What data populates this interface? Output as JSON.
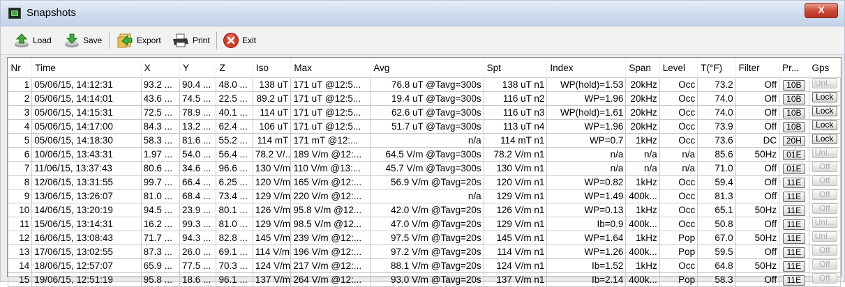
{
  "window": {
    "title": "Snapshots",
    "close_label": "X"
  },
  "toolbar": {
    "load_label": "Load",
    "save_label": "Save",
    "export_label": "Export",
    "print_label": "Print",
    "exit_label": "Exit"
  },
  "table": {
    "columns": [
      "Nr",
      "Time",
      "X",
      "Y",
      "Z",
      "Iso",
      "Max",
      "Avg",
      "Spt",
      "Index",
      "Span",
      "Level",
      "T(°F)",
      "Filter",
      "Pr...",
      "Gps"
    ],
    "rows": [
      [
        "1",
        "05/06/15, 14:12:31",
        "93.2 ...",
        "90.4 ...",
        "48.0 ...",
        "138 uT",
        "171 uT @12:5...",
        "76.8 uT @Tavg=300s",
        "138 uT n1",
        "WP(hold)=1.53",
        "20kHz",
        "Occ",
        "73.2",
        "Off",
        "10B",
        "Unl..."
      ],
      [
        "2",
        "05/06/15, 14:14:01",
        "43.6 ...",
        "74.5 ...",
        "22.5 ...",
        "89.2 uT",
        "171 uT @12:5...",
        "19.4 uT @Tavg=300s",
        "116 uT n2",
        "WP=1.96",
        "20kHz",
        "Occ",
        "74.0",
        "Off",
        "10B",
        "Lock"
      ],
      [
        "3",
        "05/06/15, 14:15:31",
        "72.5 ...",
        "78.9 ...",
        "40.1 ...",
        "114 uT",
        "171 uT @12:5...",
        "62.6 uT @Tavg=300s",
        "116 uT n3",
        "WP(hold)=1.61",
        "20kHz",
        "Occ",
        "74.0",
        "Off",
        "10B",
        "Lock"
      ],
      [
        "4",
        "05/06/15, 14:17:00",
        "84.3 ...",
        "13.2 ...",
        "62.4 ...",
        "106 uT",
        "171 uT @12:5...",
        "51.7 uT @Tavg=300s",
        "113 uT n4",
        "WP=1.96",
        "20kHz",
        "Occ",
        "73.9",
        "Off",
        "10B",
        "Lock"
      ],
      [
        "5",
        "05/06/15, 14:18:30",
        "58.3 ...",
        "81.6 ...",
        "55.2 ...",
        "114 mT",
        "171 mT @12:...",
        "n/a",
        "114 mT n1",
        "WP=0.7",
        "1kHz",
        "Occ",
        "73.6",
        "DC",
        "20H",
        "Lock"
      ],
      [
        "6",
        "10/06/15, 13:43:31",
        "1.97 ...",
        "54.0 ...",
        "56.4 ...",
        "78.2 V/...",
        "189 V/m @12:...",
        "64.5 V/m @Tavg=300s",
        "78.2 V/m n1",
        "n/a",
        "n/a",
        "n/a",
        "85.6",
        "50Hz",
        "01E",
        "Unl..."
      ],
      [
        "7",
        "11/06/15, 13:37:43",
        "80.6 ...",
        "34.6 ...",
        "96.6 ...",
        "130 V/m",
        "110 V/m @13:...",
        "45.7 V/m @Tavg=300s",
        "130 V/m n1",
        "n/a",
        "n/a",
        "n/a",
        "71.0",
        "Off",
        "01E",
        "Off"
      ],
      [
        "8",
        "12/06/15, 13:31:55",
        "99.7 ...",
        "66.4 ...",
        "6.25 ...",
        "120 V/m",
        "165 V/m @12:...",
        "56.9 V/m @Tavg=20s",
        "120 V/m n1",
        "WP=0.82",
        "1kHz",
        "Occ",
        "59.4",
        "Off",
        "11E",
        "Off"
      ],
      [
        "9",
        "13/06/15, 13:26:07",
        "81.0 ...",
        "68.4 ...",
        "73.4 ...",
        "129 V/m",
        "220 V/m @12:...",
        "n/a",
        "129 V/m n1",
        "WP=1.49",
        "400k...",
        "Occ",
        "81.3",
        "Off",
        "11E",
        "Off"
      ],
      [
        "10",
        "14/06/15, 13:20:19",
        "94.5 ...",
        "23.9 ...",
        "80.1 ...",
        "126 V/m",
        "95.8 V/m @12...",
        "42.0 V/m @Tavg=20s",
        "126 V/m n1",
        "WP=0.13",
        "1kHz",
        "Occ",
        "65.1",
        "50Hz",
        "11E",
        "Off"
      ],
      [
        "11",
        "15/06/15, 13:14:31",
        "16.2 ...",
        "99.3 ...",
        "81.0 ...",
        "129 V/m",
        "98.5 V/m @12...",
        "47.0 V/m @Tavg=20s",
        "129 V/m n1",
        "Ib=0.9",
        "400k...",
        "Occ",
        "50.8",
        "Off",
        "11E",
        "Unl..."
      ],
      [
        "12",
        "16/06/15, 13:08:43",
        "71.7 ...",
        "94.3 ...",
        "82.8 ...",
        "145 V/m",
        "239 V/m @12:...",
        "97.5 V/m @Tavg=20s",
        "145 V/m n1",
        "WP=1.64",
        "1kHz",
        "Pop",
        "67.0",
        "50Hz",
        "11E",
        "Unl..."
      ],
      [
        "13",
        "17/06/15, 13:02:55",
        "87.3 ...",
        "26.0 ...",
        "69.1 ...",
        "114 V/m",
        "196 V/m @12:...",
        "97.2 V/m @Tavg=20s",
        "114 V/m n1",
        "WP=1.26",
        "400k...",
        "Pop",
        "59.5",
        "Off",
        "11E",
        "Off"
      ],
      [
        "14",
        "18/06/15, 12:57:07",
        "65.9 ...",
        "77.5 ...",
        "70.3 ...",
        "124 V/m",
        "217 V/m @12:...",
        "88.1 V/m @Tavg=20s",
        "124 V/m n1",
        "Ib=1.52",
        "1kHz",
        "Occ",
        "64.8",
        "50Hz",
        "11E",
        "Off"
      ],
      [
        "15",
        "19/06/15, 12:51:19",
        "95.8 ...",
        "18.6 ...",
        "96.1 ...",
        "137 V/m",
        "264 V/m @12:...",
        "93.0 V/m @Tavg=20s",
        "137 V/m n1",
        "Ib=2.14",
        "400k...",
        "Pop",
        "58.3",
        "Off",
        "11E",
        "Off"
      ]
    ]
  },
  "colors": {
    "titlebar": "#cfdced",
    "close": "#cf4a36",
    "grid_line": "#c8c8c8"
  }
}
